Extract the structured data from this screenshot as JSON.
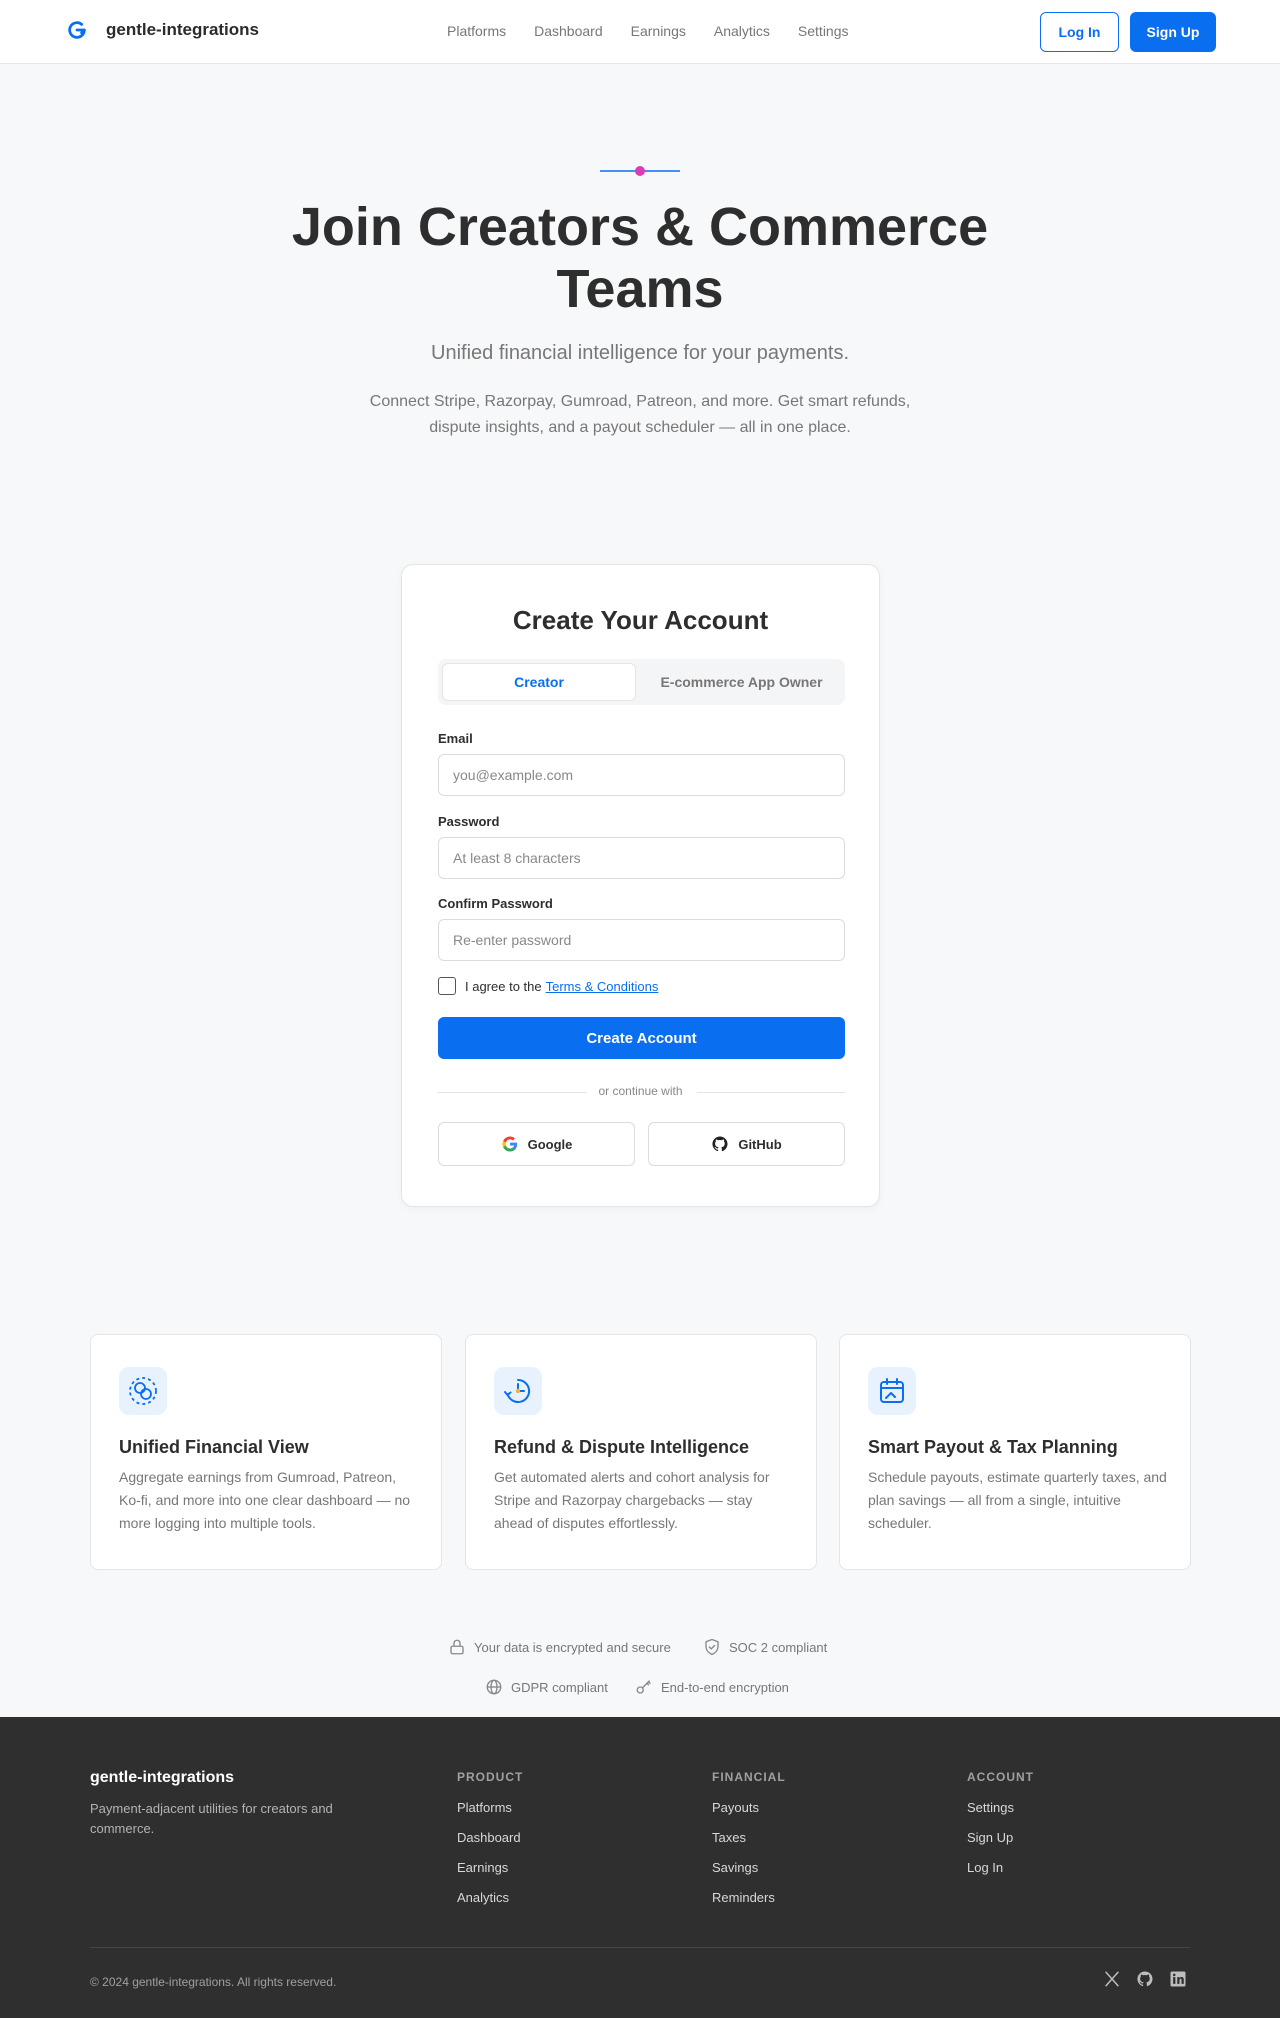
{
  "header": {
    "brand": "gentle-integrations",
    "nav": [
      "Platforms",
      "Dashboard",
      "Earnings",
      "Analytics",
      "Settings"
    ],
    "login_label": "Log In",
    "signup_label": "Sign Up"
  },
  "hero": {
    "title": "Join Creators & Commerce Teams",
    "subtitle": "Unified financial intelligence for your payments.",
    "description": "Connect Stripe, Razorpay, Gumroad, Patreon, and more. Get smart refunds, dispute insights, and a payout scheduler — all in one place."
  },
  "signup_card": {
    "title": "Create Your Account",
    "tabs": [
      "Creator",
      "E-commerce App Owner"
    ],
    "active_tab": "Creator",
    "email_label": "Email",
    "email_placeholder": "you@example.com",
    "email_value": "",
    "password_label": "Password",
    "password_placeholder": "At least 8 characters",
    "password_value": "",
    "confirm_label": "Confirm Password",
    "confirm_placeholder": "Re-enter password",
    "confirm_value": "",
    "agree_text": "I agree to the",
    "terms_link": "Terms & Conditions",
    "agree_checked": false,
    "submit_label": "Create Account",
    "divider_text": "or continue with",
    "google_label": "Google",
    "github_label": "GitHub"
  },
  "features": [
    {
      "icon": "coins-icon",
      "title": "Unified Financial View",
      "description": "Aggregate earnings from Gumroad, Patreon, Ko-fi, and more into one clear dashboard — no more logging into multiple tools."
    },
    {
      "icon": "refund-chart-icon",
      "title": "Refund & Dispute Intelligence",
      "description": "Get automated alerts and cohort analysis for Stripe and Razorpay chargebacks — stay ahead of disputes effortlessly."
    },
    {
      "icon": "calendar-chart-icon",
      "title": "Smart Payout & Tax Planning",
      "description": "Schedule payouts, estimate quarterly taxes, and plan savings — all from a single, intuitive scheduler."
    }
  ],
  "trust": {
    "encrypted": "Your data is encrypted and secure",
    "soc2": "SOC 2 compliant",
    "gdpr": "GDPR compliant",
    "e2e": "End-to-end encryption"
  },
  "footer": {
    "brand": "gentle-integrations",
    "tagline": "Payment-adjacent utilities for creators and commerce.",
    "columns": [
      {
        "heading": "PRODUCT",
        "links": [
          "Platforms",
          "Dashboard",
          "Earnings",
          "Analytics"
        ]
      },
      {
        "heading": "FINANCIAL",
        "links": [
          "Payouts",
          "Taxes",
          "Savings",
          "Reminders"
        ]
      },
      {
        "heading": "ACCOUNT",
        "links": [
          "Settings",
          "Sign Up",
          "Log In"
        ]
      }
    ],
    "copyright": "© 2024 gentle-integrations. All rights reserved.",
    "social_icons": [
      "x-icon",
      "github-icon",
      "linkedin-icon"
    ]
  },
  "colors": {
    "accent": "#0a6ef0",
    "hero_dot": "#d93fb5",
    "footer_bg": "#2f2f2f"
  }
}
